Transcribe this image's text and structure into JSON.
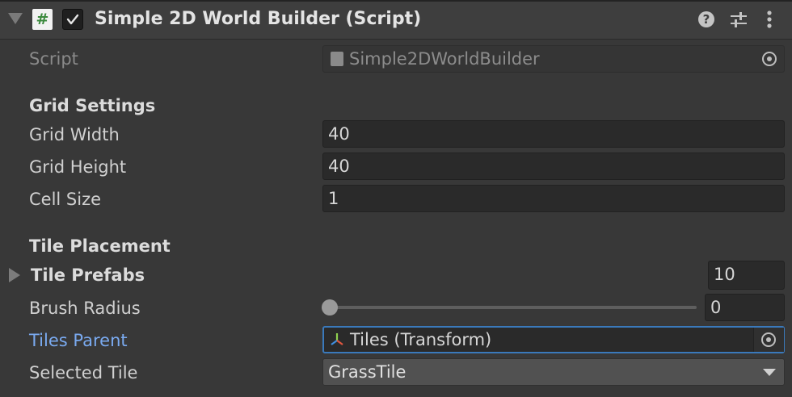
{
  "component": {
    "title": "Simple 2D World Builder (Script)",
    "enabled": true,
    "script_icon_glyph": "#",
    "help_glyph": "?",
    "icons": [
      "foldout-arrow-icon",
      "script-icon",
      "enabled-checkbox",
      "help-icon",
      "presets-icon",
      "context-menu-icon"
    ]
  },
  "fields": {
    "script": {
      "label": "Script",
      "value": "Simple2DWorldBuilder"
    },
    "grid_settings_header": "Grid Settings",
    "grid_width": {
      "label": "Grid Width",
      "value": "40"
    },
    "grid_height": {
      "label": "Grid Height",
      "value": "40"
    },
    "cell_size": {
      "label": "Cell Size",
      "value": "1"
    },
    "tile_placement_header": "Tile Placement",
    "tile_prefabs": {
      "label": "Tile Prefabs",
      "count": "10"
    },
    "brush_radius": {
      "label": "Brush Radius",
      "value": "0",
      "slider_fraction": 0
    },
    "tiles_parent": {
      "label": "Tiles Parent",
      "value": "Tiles (Transform)"
    },
    "selected_tile": {
      "label": "Selected Tile",
      "value": "GrassTile"
    }
  },
  "colors": {
    "background": "#383838",
    "header": "#3e3e3e",
    "field": "#2a2a2a",
    "focus_border": "#3a79bb",
    "highlight_label": "#7aaaf0",
    "script_icon_green": "#3c8a3e"
  }
}
